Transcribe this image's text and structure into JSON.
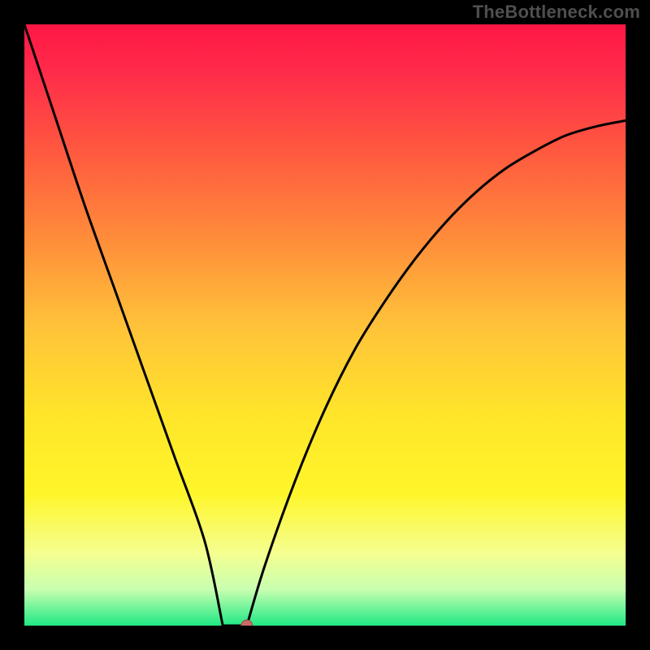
{
  "watermark": "TheBottleneck.com",
  "colors": {
    "page_bg": "#000000",
    "curve": "#000000",
    "marker_fill": "#c96a66",
    "marker_stroke": "#9c4a46",
    "gradient_stops": [
      {
        "offset": "0%",
        "color": "#ff1744"
      },
      {
        "offset": "8%",
        "color": "#ff2b4a"
      },
      {
        "offset": "20%",
        "color": "#ff5540"
      },
      {
        "offset": "35%",
        "color": "#ff8a3a"
      },
      {
        "offset": "50%",
        "color": "#ffc23a"
      },
      {
        "offset": "65%",
        "color": "#ffe52a"
      },
      {
        "offset": "78%",
        "color": "#fff62a"
      },
      {
        "offset": "88%",
        "color": "#f5ff90"
      },
      {
        "offset": "94%",
        "color": "#c8ffb0"
      },
      {
        "offset": "100%",
        "color": "#20e884"
      }
    ]
  },
  "chart_data": {
    "type": "line",
    "title": "",
    "xlabel": "",
    "ylabel": "",
    "xlim": [
      0,
      100
    ],
    "ylim": [
      0,
      100
    ],
    "optimum_x": 35,
    "flat_bottom_width": 4,
    "marker": {
      "x": 37,
      "y": 0
    },
    "series": [
      {
        "name": "bottleneck-curve",
        "x": [
          0,
          5,
          10,
          15,
          20,
          25,
          30,
          33,
          37,
          40,
          45,
          50,
          55,
          60,
          65,
          70,
          75,
          80,
          85,
          90,
          95,
          100
        ],
        "y": [
          100,
          85,
          70,
          56,
          42,
          28,
          14,
          0,
          0,
          10,
          24,
          36,
          46,
          54,
          61,
          67,
          72,
          76,
          79,
          81.5,
          83,
          84
        ]
      }
    ]
  }
}
